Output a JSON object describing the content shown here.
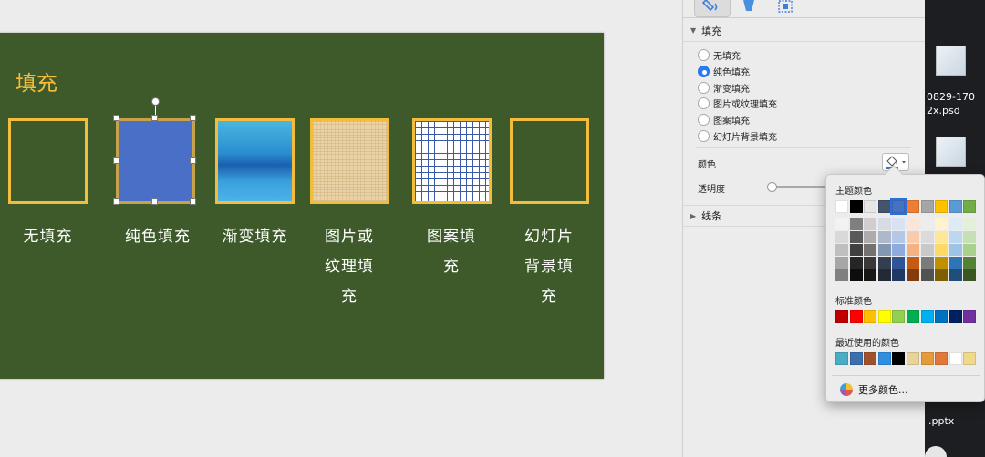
{
  "slide": {
    "title": "填充",
    "background": "#3e5a2b",
    "accent": "#f2bd3c",
    "items": [
      {
        "label": "无填充",
        "fill": "none"
      },
      {
        "label": "纯色填充",
        "fill": "#4a6fc6"
      },
      {
        "label": "渐变填充",
        "fill": "gradient"
      },
      {
        "label": "图片或纹理填充",
        "fill": "texture"
      },
      {
        "label": "图案填充",
        "fill": "pattern"
      },
      {
        "label": "幻灯片背景填充",
        "fill": "slide-background"
      }
    ]
  },
  "sidebar": {
    "tabs": [
      {
        "icon": "fill-line-icon",
        "active": true
      },
      {
        "icon": "effects-icon",
        "active": false
      },
      {
        "icon": "size-properties-icon",
        "active": false
      }
    ],
    "fill_section": {
      "title": "填充",
      "options": [
        {
          "label": "无填充",
          "selected": false
        },
        {
          "label": "纯色填充",
          "selected": true
        },
        {
          "label": "渐变填充",
          "selected": false
        },
        {
          "label": "图片或纹理填充",
          "selected": false
        },
        {
          "label": "图案填充",
          "selected": false
        },
        {
          "label": "幻灯片背景填充",
          "selected": false
        }
      ],
      "color_label": "颜色",
      "transparency_label": "透明度",
      "transparency_value": 0
    },
    "line_section": {
      "title": "线条"
    }
  },
  "color_popup": {
    "theme_title": "主题颜色",
    "theme_top": [
      "#ffffff",
      "#000000",
      "#e7e6e6",
      "#44546a",
      "#4472c4",
      "#ed7d31",
      "#a5a5a5",
      "#ffc000",
      "#5b9bd5",
      "#70ad47"
    ],
    "theme_shades": [
      [
        "#f2f2f2",
        "#7f7f7f",
        "#d0cece",
        "#d6dce5",
        "#d9e2f3",
        "#fbe5d6",
        "#ededed",
        "#fff2cc",
        "#deebf7",
        "#e2f0d9"
      ],
      [
        "#d9d9d9",
        "#595959",
        "#aeabab",
        "#adb9ca",
        "#b4c7e7",
        "#f8cbad",
        "#dbdbdb",
        "#ffe699",
        "#bdd7ee",
        "#c5e0b4"
      ],
      [
        "#bfbfbf",
        "#404040",
        "#757171",
        "#8497b0",
        "#8faadc",
        "#f4b183",
        "#c9c9c9",
        "#ffd966",
        "#9dc3e6",
        "#a9d18e"
      ],
      [
        "#a6a6a6",
        "#262626",
        "#3b3838",
        "#333f50",
        "#2f5597",
        "#c55a11",
        "#7b7b7b",
        "#bf9000",
        "#2e75b6",
        "#548235"
      ],
      [
        "#808080",
        "#0d0d0d",
        "#181717",
        "#222a35",
        "#1f3864",
        "#843c0c",
        "#525252",
        "#7f6000",
        "#1f4e79",
        "#385723"
      ]
    ],
    "standard_title": "标准颜色",
    "standard": [
      "#c00000",
      "#ff0000",
      "#ffc000",
      "#ffff00",
      "#92d050",
      "#00b050",
      "#00b0f0",
      "#0070c0",
      "#002060",
      "#7030a0"
    ],
    "recent_title": "最近使用的颜色",
    "recent": [
      "#4bacc6",
      "#3a6fb0",
      "#a0522d",
      "#2f8ee0",
      "#000000",
      "#e8d39a",
      "#e79a3a",
      "#e2773a",
      "#ffffff",
      "#f0d98a"
    ],
    "more_label": "更多颜色..."
  },
  "desktop": {
    "file1_line1": "0829-170",
    "file1_line2": "2x.psd",
    "file2": ".pptx"
  }
}
